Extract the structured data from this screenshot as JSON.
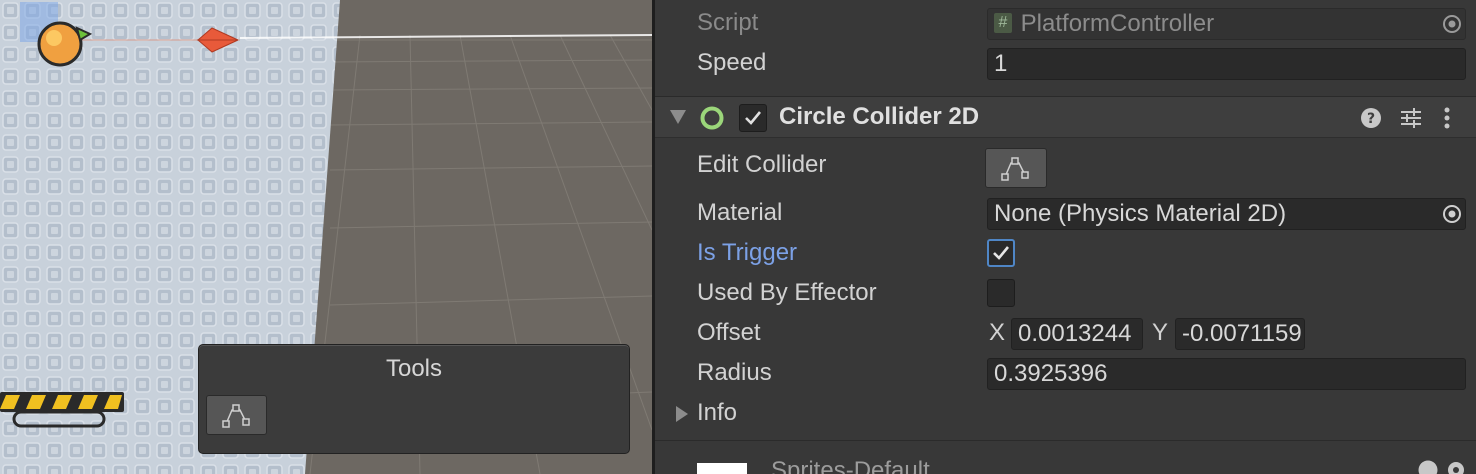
{
  "scene": {
    "tools_panel": {
      "title": "Tools",
      "edit_collider_tool_icon": "edit-collider-icon"
    }
  },
  "inspector": {
    "script": {
      "label": "Script",
      "value": "PlatformController",
      "icon": "script-hash-icon"
    },
    "speed": {
      "label": "Speed",
      "value": "1"
    },
    "circle_collider": {
      "title": "Circle Collider 2D",
      "enabled": true,
      "icons": [
        "foldout-arrow-icon",
        "circle-collider-icon",
        "help-icon",
        "presets-icon",
        "more-icon"
      ]
    },
    "edit_collider": {
      "label": "Edit Collider"
    },
    "material": {
      "label": "Material",
      "value": "None (Physics Material 2D)"
    },
    "is_trigger": {
      "label": "Is Trigger",
      "checked": true
    },
    "used_by_effector": {
      "label": "Used By Effector",
      "checked": false
    },
    "offset": {
      "label": "Offset",
      "x_label": "X",
      "x_value": "0.0013244",
      "y_label": "Y",
      "y_value": "-0.0071159"
    },
    "radius": {
      "label": "Radius",
      "value": "0.3925396"
    },
    "info": {
      "label": "Info"
    },
    "next_component": {
      "label": "Sprites-Default"
    }
  },
  "colors": {
    "accent_blue": "#7ca1e6",
    "collider_green": "#9bd67a"
  }
}
